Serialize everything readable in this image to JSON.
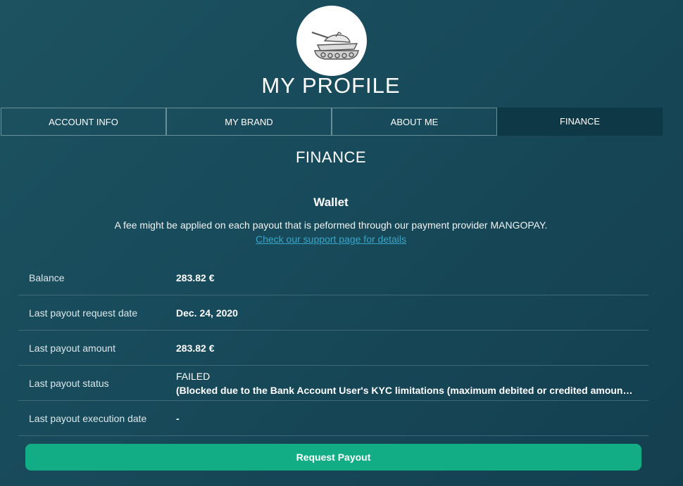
{
  "header": {
    "title": "MY PROFILE",
    "avatar_icon": "tank-icon"
  },
  "tabs": [
    {
      "label": "ACCOUNT INFO",
      "active": false
    },
    {
      "label": "MY BRAND",
      "active": false
    },
    {
      "label": "ABOUT ME",
      "active": false
    },
    {
      "label": "FINANCE",
      "active": true
    }
  ],
  "finance": {
    "section_title": "FINANCE",
    "wallet_title": "Wallet",
    "fee_notice": "A fee might be applied on each payout that is peformed through our payment provider MANGOPAY.",
    "support_link": "Check our support page for details",
    "rows": [
      {
        "label": "Balance",
        "value": "283.82 €"
      },
      {
        "label": "Last payout request date",
        "value": "Dec. 24, 2020"
      },
      {
        "label": "Last payout amount",
        "value": "283.82 €"
      },
      {
        "label": "Last payout status",
        "value": "FAILED",
        "detail": "(Blocked due to the Bank Account User's KYC limitations (maximum debited or credited amount reached))"
      },
      {
        "label": "Last payout execution date",
        "value": "-"
      }
    ],
    "request_button": "Request Payout"
  },
  "colors": {
    "background": "#174a5a",
    "active_tab": "#0f3846",
    "button": "#13ad85",
    "link": "#3aa6c9"
  }
}
